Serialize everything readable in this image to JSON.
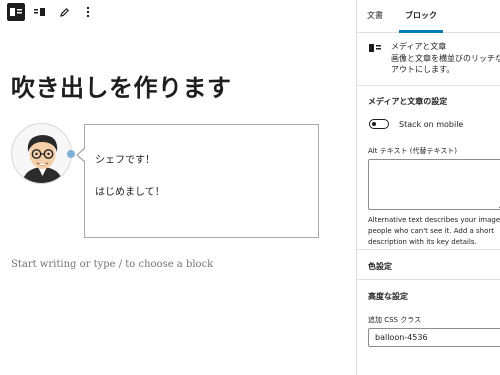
{
  "toolbar": {
    "buttons": [
      {
        "icon": "media-text-block-icon",
        "active": true
      },
      {
        "icon": "align-left-media-icon",
        "active": false
      },
      {
        "icon": "pencil-edit-icon",
        "active": false
      },
      {
        "icon": "more-vertical-icon",
        "active": false
      }
    ]
  },
  "editor": {
    "title": "吹き出しを作ります",
    "balloon": {
      "lines": [
        "シェフです！",
        "はじめまして！"
      ]
    },
    "placeholder": "Start writing or type / to choose a block"
  },
  "sidebar": {
    "tabs": [
      {
        "label": "文書",
        "selected": false
      },
      {
        "label": "ブロック",
        "selected": true
      }
    ],
    "block_card": {
      "name": "メディアと文章",
      "description_lines": [
        "画像と文章を横並びのリッチな",
        "アウトにします。"
      ]
    },
    "settings": {
      "title": "メディアと文章の設定",
      "toggle_label": "Stack on mobile",
      "toggle_on": false,
      "alt_label": "Alt テキスト (代替テキスト)",
      "alt_value": "",
      "alt_help_lines": [
        "Alternative text describes your image",
        "people who can't see it. Add a short",
        "description with its key details."
      ]
    },
    "color": {
      "title": "色設定"
    },
    "advanced": {
      "title": "高度な設定",
      "css_label": "追加 CSS クラス",
      "css_value": "balloon-4536"
    }
  },
  "colors": {
    "accent": "#007cba",
    "balloon_dot": "#7fb0d6",
    "text": "#1e1e1e"
  }
}
